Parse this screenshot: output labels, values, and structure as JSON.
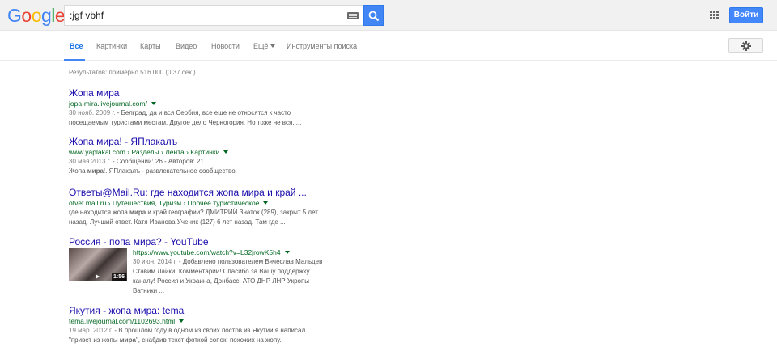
{
  "header": {
    "logo": [
      "G",
      "o",
      "o",
      "g",
      "l",
      "e"
    ],
    "query": ":jgf vbhf",
    "signin_label": "Войти"
  },
  "tabs": [
    {
      "label": "Все"
    },
    {
      "label": "Картинки"
    },
    {
      "label": "Карты"
    },
    {
      "label": "Видео"
    },
    {
      "label": "Новости"
    },
    {
      "label": "Ещё"
    },
    {
      "label": "Инструменты поиска"
    }
  ],
  "stats": "Результатов: примерно 516 000 (0,37 сек.)",
  "results": [
    {
      "title": "Жопа мира",
      "url": "jopa-mira.livejournal.com/",
      "date": "30 нояб. 2009 г.",
      "snippet_l1": " - Белград, да и вся Сербия, все еще не относятся к часто",
      "snippet_l2": "посещаемым туристами местам. Другое дело Черногория. Но тоже не вся, ..."
    },
    {
      "title": "Жопа мира! - ЯПлакалъ",
      "url": "www.yaplakal.com › Разделы › Лента › Картинки",
      "date": "30 мая 2013 г.",
      "snippet_l1": " - Сообщений: 26 - Авторов: 21",
      "snippet_pre": "Жопа ",
      "snippet_bold": "мира",
      "snippet_post": "!. ЯПлакалъ - развлекательное сообщество."
    },
    {
      "title": "Ответы@Mail.Ru: где находится жопа мира и край ...",
      "url": "otvet.mail.ru › Путешествия, Туризм › Прочее туристическое",
      "snippet_l1_pre": "где находится жопа ",
      "snippet_l1_bold": "мира",
      "snippet_l1_post": " и край географии? ДМИТРИЙ Знаток (289), закрыт 5 лет",
      "snippet_l2": "назад. Лучший ответ. Катя Иванова Ученик (127) 6 лет назад. Там где ..."
    },
    {
      "title": "Россия - попа мира? - YouTube",
      "url": "https://www.youtube.com/watch?v=L32jrowK5h4",
      "date": "30 июн. 2014 г.",
      "snippet_l1": " - Добавлено пользователем Вячеслав Мальцев",
      "snippet_l2": "Ставим Лайки, Комментарии! Спасибо за Вашу поддержку",
      "snippet_l3": "каналу! Россия и Украина, Донбасс, АТО ДНР ЛНР Укропы",
      "snippet_l4": "Ватники ...",
      "duration": "1:56"
    },
    {
      "title": "Якутия - жопа мира: tema",
      "url": "tema.livejournal.com/1102693.html",
      "date": "19 мар. 2012 г.",
      "snippet_l1": " - В прошлом году в одном из своих постов из Якутии я написал",
      "snippet_l2_pre": "\"привет из жопы ",
      "snippet_l2_bold": "мира",
      "snippet_l2_post": "\", снабдив текст фоткой сопок, похожих на жопу."
    }
  ]
}
